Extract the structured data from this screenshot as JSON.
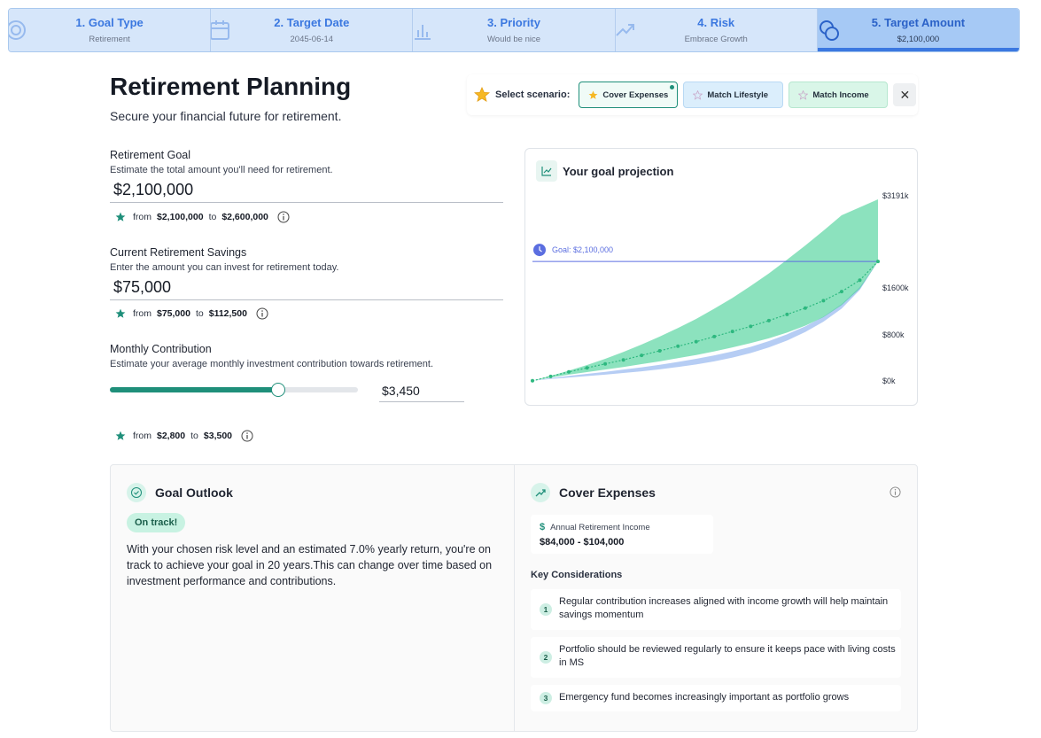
{
  "steps": [
    {
      "title": "1. Goal Type",
      "sub": "Retirement",
      "icon": "target-icon"
    },
    {
      "title": "2. Target Date",
      "sub": "2045-06-14",
      "icon": "calendar-icon"
    },
    {
      "title": "3. Priority",
      "sub": "Would be nice",
      "icon": "bar-chart-icon"
    },
    {
      "title": "4. Risk",
      "sub": "Embrace Growth",
      "icon": "trend-arrow-icon"
    },
    {
      "title": "5. Target Amount",
      "sub": "$2,100,000",
      "icon": "coins-icon",
      "active": true
    }
  ],
  "header": {
    "title": "Retirement Planning",
    "subtitle": "Secure your financial future for retirement."
  },
  "scenario": {
    "label": "Select scenario:",
    "options": [
      "Cover Expenses",
      "Match Lifestyle",
      "Match Income"
    ],
    "selected": "Cover Expenses",
    "close": "✕"
  },
  "fields": {
    "goal": {
      "label": "Retirement Goal",
      "help": "Estimate the total amount you'll need for retirement.",
      "value": "$2,100,000",
      "range_from_label": "from",
      "range_from": "$2,100,000",
      "range_to_label": "to",
      "range_to": "$2,600,000"
    },
    "savings": {
      "label": "Current Retirement Savings",
      "help": "Enter the amount you can invest for retirement today.",
      "value": "$75,000",
      "range_from_label": "from",
      "range_from": "$75,000",
      "range_to_label": "to",
      "range_to": "$112,500"
    },
    "contribution": {
      "label": "Monthly Contribution",
      "help": "Estimate your average monthly investment contribution towards retirement.",
      "value": "$3,450",
      "slider_fraction": 0.68,
      "range_from_label": "from",
      "range_from": "$2,800",
      "range_to_label": "to",
      "range_to": "$3,500"
    }
  },
  "projection": {
    "title": "Your goal projection",
    "goal_label": "Goal: $2,100,000"
  },
  "chart_data": {
    "type": "area",
    "title": "Your goal projection",
    "y_tick_labels": [
      "$0k",
      "$800k",
      "$1600k",
      "$3191k"
    ],
    "y_ticks": [
      0,
      800000,
      1600000,
      3191000
    ],
    "goal": 2100000,
    "x": [
      0,
      1,
      2,
      3,
      4,
      5,
      6,
      7,
      8,
      9,
      10,
      11,
      12,
      13,
      14,
      15,
      16,
      17,
      18,
      19
    ],
    "series": [
      {
        "name": "",
        "values": [
          3000,
          80000,
          160000,
          230000,
          300000,
          370000,
          450000,
          530000,
          610000,
          690000,
          780000,
          870000,
          960000,
          1060000,
          1170000,
          1280000,
          1410000,
          1570000,
          1770000,
          2100000
        ]
      }
    ],
    "band_upper": [
      3000,
      90000,
      180000,
      280000,
      390000,
      510000,
      640000,
      780000,
      930000,
      1090000,
      1270000,
      1460000,
      1670000,
      1890000,
      2130000,
      2380000,
      2640000,
      2910000,
      3050000,
      3191000
    ],
    "band_lower": [
      3000,
      60000,
      110000,
      155000,
      200000,
      245000,
      295000,
      345000,
      400000,
      455000,
      520000,
      590000,
      665000,
      750000,
      850000,
      970000,
      1120000,
      1330000,
      1620000,
      2100000
    ],
    "low_band_upper": [
      3000,
      50000,
      90000,
      125000,
      160000,
      200000,
      240000,
      285000,
      335000,
      390000,
      450000,
      520000,
      600000,
      700000,
      820000,
      960000,
      1130000,
      1350000,
      1650000,
      2100000
    ],
    "low_band_lower": [
      3000,
      35000,
      60000,
      85000,
      110000,
      140000,
      170000,
      205000,
      245000,
      290000,
      345000,
      410000,
      490000,
      590000,
      710000,
      860000,
      1040000,
      1270000,
      1600000,
      2100000
    ]
  },
  "outlook": {
    "title": "Goal Outlook",
    "badge": "On track!",
    "text": "With your chosen risk level and an estimated 7.0% yearly return, you're on track to achieve your goal in 20 years.This can change over time based on investment performance and contributions."
  },
  "cover": {
    "title": "Cover Expenses",
    "income_label": "Annual Retirement Income",
    "income_value": "$84,000 - $104,000",
    "kc_title": "Key Considerations",
    "items": [
      {
        "num": "1",
        "text": "Regular contribution increases aligned with income growth will help maintain savings momentum"
      },
      {
        "num": "2",
        "text": "Portfolio should be reviewed regularly to ensure it keeps pace with living costs in MS"
      },
      {
        "num": "3",
        "text": "Emergency fund becomes increasingly important as portfolio grows"
      }
    ]
  },
  "colors": {
    "accent": "#1f8f7a",
    "step_active": "#a6c9f5",
    "step_text": "#3b78e0",
    "goal_line": "#5b6ee0",
    "band_green": "#3fcf93",
    "band_blue": "#a9c4f2"
  }
}
